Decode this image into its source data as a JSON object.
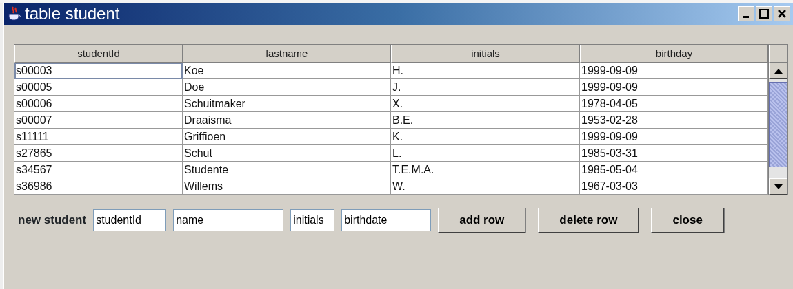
{
  "window": {
    "title": "table student"
  },
  "table": {
    "columns": [
      "studentId",
      "lastname",
      "initials",
      "birthday"
    ],
    "rows": [
      {
        "cells": [
          "s00003",
          "Koe",
          "H.",
          "1999-09-09"
        ],
        "focused": true
      },
      {
        "cells": [
          "s00005",
          "Doe",
          "J.",
          "1999-09-09"
        ],
        "focused": false
      },
      {
        "cells": [
          "s00006",
          "Schuitmaker",
          "X.",
          "1978-04-05"
        ],
        "focused": false
      },
      {
        "cells": [
          "s00007",
          "Draaisma",
          "B.E.",
          "1953-02-28"
        ],
        "focused": false
      },
      {
        "cells": [
          "s11111",
          "Griffioen",
          "K.",
          "1999-09-09"
        ],
        "focused": false
      },
      {
        "cells": [
          "s27865",
          "Schut",
          "L.",
          "1985-03-31"
        ],
        "focused": false
      },
      {
        "cells": [
          "s34567",
          "Studente",
          "T.E.M.A.",
          "1985-05-04"
        ],
        "focused": false
      },
      {
        "cells": [
          "s36986",
          "Willems",
          "W.",
          "1967-03-03"
        ],
        "focused": false
      }
    ]
  },
  "form": {
    "label": "new student",
    "fields": [
      {
        "value": "studentId"
      },
      {
        "value": "name"
      },
      {
        "value": "initials"
      },
      {
        "value": "birthdate"
      }
    ],
    "buttons": [
      "add row",
      "delete row",
      "close"
    ]
  }
}
